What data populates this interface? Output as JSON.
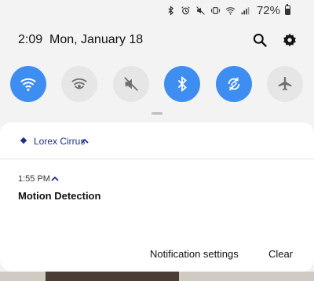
{
  "status_bar": {
    "icons": [
      "bluetooth-icon",
      "alarm-icon",
      "mute-icon",
      "vibrate-icon",
      "wifi-icon",
      "signal-icon"
    ],
    "battery_percent_text": "72%",
    "battery_level": 0.72
  },
  "header": {
    "time": "2:09",
    "date": "Mon, January 18",
    "search_icon": "search-icon",
    "settings_icon": "gear-icon"
  },
  "quick_toggles": [
    {
      "name": "wifi",
      "icon": "wifi-icon",
      "state": "on"
    },
    {
      "name": "mobile-hotspot",
      "icon": "hotspot-icon",
      "state": "off"
    },
    {
      "name": "sound",
      "icon": "mute-icon",
      "state": "off"
    },
    {
      "name": "bluetooth",
      "icon": "bluetooth-icon",
      "state": "on"
    },
    {
      "name": "auto-rotate",
      "icon": "rotate-icon",
      "state": "on"
    },
    {
      "name": "airplane-mode",
      "icon": "airplane-icon",
      "state": "off"
    }
  ],
  "colors": {
    "accent_on": "#3e8df0",
    "toggle_off": "#e6e6e6",
    "app_name": "#1e2f8a"
  },
  "notification": {
    "app_name": "Lorex Cirrus",
    "time": "1:55 PM",
    "title": "Motion Detection",
    "actions": {
      "settings": "Notification settings",
      "clear": "Clear"
    }
  }
}
